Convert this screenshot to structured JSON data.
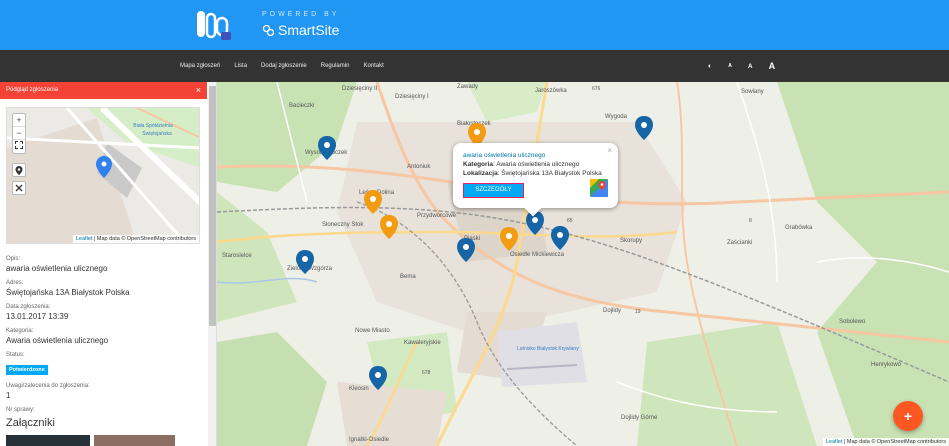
{
  "header": {
    "powered_by": "POWERED BY",
    "brand": "SmartSite"
  },
  "nav": {
    "links": [
      "Mapa zgłoszeń",
      "Lista",
      "Dodaj zgłoszenie",
      "Regulamin",
      "Kontakt"
    ],
    "tools": [
      "◐",
      "A",
      "A",
      "A"
    ]
  },
  "panel": {
    "header": "Podgląd zgłoszenia",
    "close": "×",
    "minimap": {
      "zoom_in": "+",
      "zoom_out": "−",
      "attribution_link": "Leaflet",
      "attribution_text": " | Map data © OpenStreetMap contributors",
      "labels": [
        "Biała Spółdzielnia",
        "Świętojańska"
      ]
    },
    "fields": {
      "description_label": "Opis:",
      "description": "awaria oświetlenia ulicznego",
      "address_label": "Adres:",
      "address": "Świętojańska 13A Białystok Polska",
      "date_label": "Data zgłoszenia:",
      "date": "13.01.2017 13:39",
      "category_label": "Kategoria:",
      "category": "Awaria oświetlenia ulicznego",
      "status_label": "Status:",
      "status": "Potwierdzone",
      "comments_label": "Uwagi/zalecenia do zgłoszenia:",
      "comments": "1",
      "case_label": "Nr sprawy:",
      "attachments_title": "Załączniki"
    }
  },
  "map": {
    "attribution_link": "Leaflet",
    "attribution_text": " | Map data © OpenStreetMap contributors",
    "labels": [
      {
        "id": "bacieczki",
        "text": "Bacieczki"
      },
      {
        "id": "dziesieciny",
        "text": "Dziesięciny II"
      },
      {
        "id": "dziesieciny1",
        "text": "Dziesięciny I"
      },
      {
        "id": "zawady",
        "text": "Zawady"
      },
      {
        "id": "jaroszowka",
        "text": "Jaroszówka"
      },
      {
        "id": "wysoki",
        "text": "Wysoki Stoczek"
      },
      {
        "id": "bialostoczek",
        "text": "Białostoczek"
      },
      {
        "id": "antoniuk",
        "text": "Antoniuk"
      },
      {
        "id": "wygoda",
        "text": "Wygoda"
      },
      {
        "id": "sowlany",
        "text": "Sowlany"
      },
      {
        "id": "zielone",
        "text": "Zielone Wzgórza"
      },
      {
        "id": "starosielce",
        "text": "Starosielce"
      },
      {
        "id": "leszczynowe",
        "text": "Leśna Dolina"
      },
      {
        "id": "przydworcowe",
        "text": "Przydworcowe"
      },
      {
        "id": "bema",
        "text": "Bema"
      },
      {
        "id": "sloneczny",
        "text": "Słoneczny Stok"
      },
      {
        "id": "mickiewicza",
        "text": "Osiedle Mickiewicza"
      },
      {
        "id": "piaski",
        "text": "Piaski"
      },
      {
        "id": "skorupy",
        "text": "Skorupy"
      },
      {
        "id": "zascianki",
        "text": "Zaścianki"
      },
      {
        "id": "grabowka",
        "text": "Grabówka"
      },
      {
        "id": "dojlidy",
        "text": "Dojlidy"
      },
      {
        "id": "nowemiasto",
        "text": "Nowe Miasto"
      },
      {
        "id": "kawaleryjskie",
        "text": "Kawaleryjskie"
      },
      {
        "id": "lotnisko",
        "text": "Lotnisko Białystok Krywlany"
      },
      {
        "id": "kleosin",
        "text": "Kleosin"
      },
      {
        "id": "dojlidygorne",
        "text": "Dojlidy Górne"
      },
      {
        "id": "sobolewo",
        "text": "Sobolewo"
      },
      {
        "id": "henrykowo",
        "text": "Henrykowo"
      },
      {
        "id": "ignatki",
        "text": "Ignatki-Osiedle"
      },
      {
        "id": "r676",
        "text": "676"
      },
      {
        "id": "r19",
        "text": "19"
      },
      {
        "id": "r8",
        "text": "8"
      },
      {
        "id": "r65",
        "text": "65"
      },
      {
        "id": "r678",
        "text": "678"
      }
    ],
    "popup": {
      "title": "awaria oświetlenia ulicznego",
      "category_key": "Kategoria",
      "category_value": ": Awaria oświetlenia ulicznego",
      "location_key": "Lokalizacja",
      "location_value": ": Świętojańska 13A Białystok Polska",
      "button": "SZCZEGÓŁY",
      "close": "×"
    },
    "fab": "+"
  },
  "colors": {
    "header": "#2196f3",
    "nav": "#333333",
    "panel_header": "#f44336",
    "marker_blue": "#1565a7",
    "marker_orange": "#f39c12",
    "badge": "#03a9f4",
    "fab": "#ff5722"
  }
}
